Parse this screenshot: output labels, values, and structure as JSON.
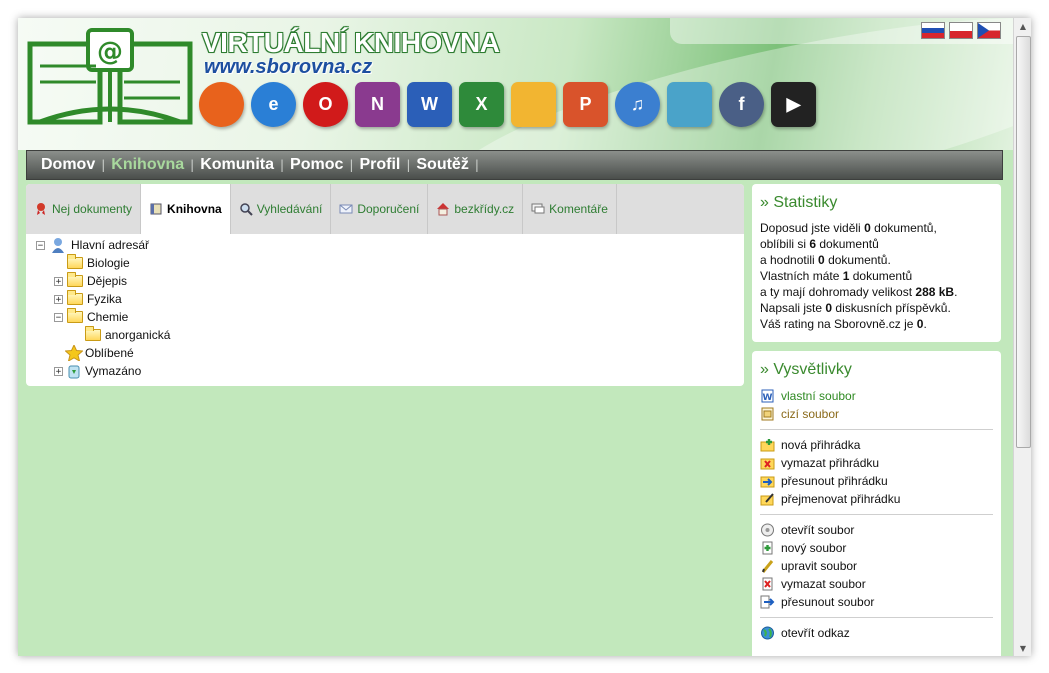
{
  "brand": {
    "title": "VIRTUÁLNÍ KNIHOVNA",
    "url": "www.sborovna.cz"
  },
  "app_icons": [
    {
      "name": "firefox-icon",
      "glyph": "",
      "color": "#e8621c"
    },
    {
      "name": "internet-explorer-icon",
      "glyph": "e",
      "color": "#2a7fd6"
    },
    {
      "name": "opera-icon",
      "glyph": "O",
      "color": "#d11a1a"
    },
    {
      "name": "onenote-icon",
      "glyph": "N",
      "color": "#8a3a8f"
    },
    {
      "name": "word-icon",
      "glyph": "W",
      "color": "#2b5fb8"
    },
    {
      "name": "excel-icon",
      "glyph": "X",
      "color": "#2e8a3a"
    },
    {
      "name": "outlook-icon",
      "glyph": "",
      "color": "#f2b531"
    },
    {
      "name": "powerpoint-icon",
      "glyph": "P",
      "color": "#d9532b"
    },
    {
      "name": "music-cd-icon",
      "glyph": "♫",
      "color": "#3b7fd0"
    },
    {
      "name": "quill-icon",
      "glyph": "",
      "color": "#4aa3c9"
    },
    {
      "name": "flash-icon",
      "glyph": "f",
      "color": "#4a5f86"
    },
    {
      "name": "avi-video-icon",
      "glyph": "▶",
      "color": "#222222"
    }
  ],
  "flags": [
    "slovak-flag-icon",
    "polish-flag-icon",
    "czech-flag-icon"
  ],
  "nav": {
    "items": [
      "Domov",
      "Knihovna",
      "Komunita",
      "Pomoc",
      "Profil",
      "Soutěž"
    ],
    "active": "Knihovna"
  },
  "tabs": [
    {
      "label": "Nej dokumenty",
      "icon": "ribbon-icon"
    },
    {
      "label": "Knihovna",
      "icon": "book-icon"
    },
    {
      "label": "Vyhledávání",
      "icon": "magnifier-icon"
    },
    {
      "label": "Doporučení",
      "icon": "envelope-icon"
    },
    {
      "label": "bezkřídy.cz",
      "icon": "house-icon"
    },
    {
      "label": "Komentáře",
      "icon": "comment-icon"
    }
  ],
  "active_tab": "Knihovna",
  "tree": {
    "root": "Hlavní adresář",
    "items": [
      {
        "label": "Biologie",
        "level": 1,
        "toggle": ""
      },
      {
        "label": "Dějepis",
        "level": 1,
        "toggle": "+"
      },
      {
        "label": "Fyzika",
        "level": 1,
        "toggle": "+"
      },
      {
        "label": "Chemie",
        "level": 1,
        "toggle": "−"
      },
      {
        "label": "anorganická",
        "level": 2,
        "toggle": ""
      },
      {
        "label": "Oblíbené",
        "level": 1,
        "toggle": "",
        "icon": "star-icon"
      },
      {
        "label": "Vymazáno",
        "level": 1,
        "toggle": "+",
        "icon": "recycle-bin-icon"
      }
    ]
  },
  "stats": {
    "title": "» Statistiky",
    "l1a": "Doposud jste viděli ",
    "l1b": "0",
    "l1c": " dokumentů,",
    "l2a": "oblíbili si ",
    "l2b": "6",
    "l2c": " dokumentů",
    "l3a": "a hodnotili ",
    "l3b": "0",
    "l3c": " dokumentů.",
    "l4a": "Vlastních máte ",
    "l4b": "1",
    "l4c": " dokumentů",
    "l5a": "a ty mají dohromady velikost ",
    "l5b": "288 kB",
    "l5c": ".",
    "l6a": "Napsali jste ",
    "l6b": "0",
    "l6c": " diskusních příspěvků.",
    "l7a": "Váš rating na Sborovně.cz je ",
    "l7b": "0",
    "l7c": "."
  },
  "legend": {
    "title": "» Vysvětlivky",
    "files": [
      "vlastní soubor",
      "cizí soubor"
    ],
    "folder_actions": [
      "nová přihrádka",
      "vymazat přihrádku",
      "přesunout přihrádku",
      "přejmenovat přihrádku"
    ],
    "file_actions": [
      "otevřít soubor",
      "nový soubor",
      "upravit soubor",
      "vymazat soubor",
      "přesunout soubor"
    ],
    "link_actions": [
      "otevřít odkaz"
    ]
  }
}
